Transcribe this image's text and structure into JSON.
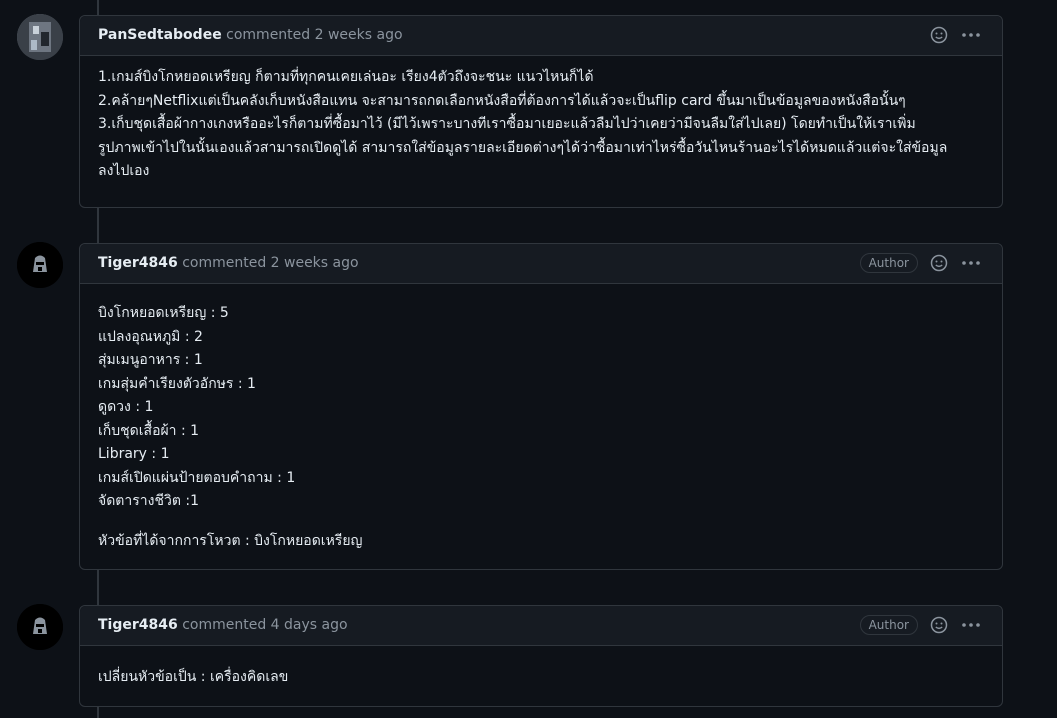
{
  "comments": [
    {
      "user": "PanSedtabodee",
      "meta": "commented 2 weeks ago",
      "is_author": false,
      "lines": [
        "1.เกมส์บิงโกหยอดเหรียญ ก็ตามที่ทุกคนเคยเล่นอะ เรียง4ตัวถึงจะชนะ แนวไหนก็ได้",
        "2.คล้ายๆNetflixแต่เป็นคลังเก็บหนังสือแทน จะสามารถกดเลือกหนังสือที่ต้องการได้แล้วจะเป็นflip card ขึ้นมาเป็นข้อมูลของหนังสือนั้นๆ",
        "3.เก็บชุดเสื้อผ้ากางเกงหรืออะไรก็ตามที่ซื้อมาไว้ (มีไว้เพราะบางทีเราซื้อมาเยอะแล้วลืมไปว่าเคยว่ามีจนลืมใส่ไปเลย) โดยทำเป็นให้เราเพิ่ม",
        "รูปภาพเข้าไปในนั้นเองแล้วสามารถเปิดดูได้ สามารถใส่ข้อมูลรายละเอียดต่างๆได้ว่าซื้อมาเท่าไหร่ซื้อวันไหนร้านอะไรได้หมดแล้วแต่จะใส่ข้อมูล",
        "ลงไปเอง"
      ]
    },
    {
      "user": "Tiger4846",
      "meta": "commented 2 weeks ago",
      "is_author": true,
      "author_label": "Author",
      "lines": [
        "บิงโกหยอดเหรียญ : 5",
        "แปลงอุณหภูมิ : 2",
        "สุ่มเมนูอาหาร : 1",
        "เกมสุ่มคำเรียงตัวอักษร : 1",
        "ดูดวง : 1",
        "เก็บชุดเสื้อผ้า : 1",
        "Library : 1",
        "เกมส์เปิดแผ่นป้ายตอบคำถาม : 1",
        "จัดตารางชีวิต :1"
      ],
      "footer": "หัวข้อที่ได้จากการโหวต : บิงโกหยอดเหรียญ"
    },
    {
      "user": "Tiger4846",
      "meta": "commented 4 days ago",
      "is_author": true,
      "author_label": "Author",
      "lines": [
        "เปลี่ยนหัวข้อเป็น : เครื่องคิดเลข"
      ]
    }
  ],
  "icons": {
    "reaction": "smiley-icon",
    "menu": "kebab-menu-icon"
  },
  "colors": {
    "background": "#0d1117",
    "header": "#161b22",
    "border": "#30363d",
    "muted": "#8b949e",
    "text": "#e6edf3"
  }
}
